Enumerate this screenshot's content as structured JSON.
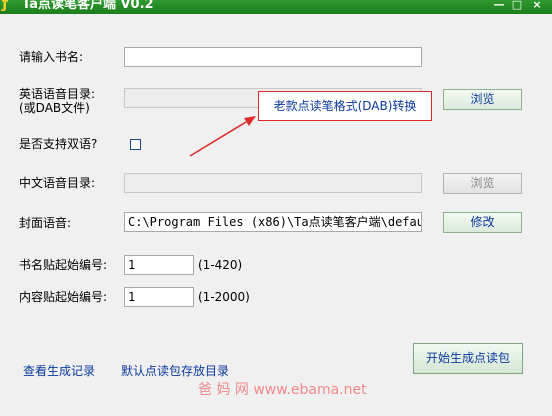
{
  "window": {
    "title": "Ta点读笔客户端 V0.2",
    "icon": "app-logo-icon",
    "buttons": {
      "minimize": "—",
      "maximize": "□",
      "close": "×"
    },
    "accent_color": "#1f851f"
  },
  "form": {
    "book_name": {
      "label": "请输入书名:",
      "value": ""
    },
    "english_dir": {
      "label_line1": "英语语音目录:",
      "label_line2": "(或DAB文件)",
      "value": "",
      "browse_label": "浏览"
    },
    "bilingual": {
      "label": "是否支持双语?",
      "checked": false
    },
    "chinese_dir": {
      "label": "中文语音目录:",
      "value": "",
      "browse_label": "浏览"
    },
    "cover_audio": {
      "label": "封面语音:",
      "value": "C:\\Program Files (x86)\\Ta点读笔客户端\\defau",
      "modify_label": "修改"
    },
    "title_sticker_start": {
      "label": "书名贴起始编号:",
      "value": "1",
      "range": "(1-420)"
    },
    "content_sticker_start": {
      "label": "内容贴起始编号:",
      "value": "1",
      "range": "(1-2000)"
    }
  },
  "popup": {
    "label": "老款点读笔格式(DAB)转换",
    "border_color": "#e02a2a"
  },
  "footer": {
    "view_records_link": "查看生成记录",
    "default_dir_link": "默认点读包存放目录",
    "generate_button": "开始生成点读包"
  },
  "watermark": "爸 妈 网  www.ebama.net"
}
